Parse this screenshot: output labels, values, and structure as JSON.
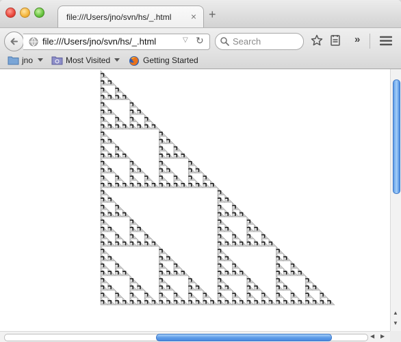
{
  "tab": {
    "title": "file:///Users/jno/svn/hs/_.html",
    "close": "×",
    "new_tab": "+"
  },
  "navbar": {
    "url": "file:///Users/jno/svn/hs/_.html",
    "search_placeholder": "Search",
    "overflow": "»"
  },
  "bookmarks": {
    "items": [
      {
        "label": "jno",
        "icon": "folder-icon"
      },
      {
        "label": "Most Visited",
        "icon": "folder-icon"
      },
      {
        "label": "Getting Started",
        "icon": "firefox-icon"
      }
    ]
  },
  "content": {
    "figure": "sierpinski-triangle",
    "recursion_depth": 4,
    "fill_color": "#cbcbcb",
    "line_color": "#1a1a1a"
  },
  "colors": {
    "scroll_thumb": "#5f9de8",
    "chrome": "#e1e1e1"
  }
}
